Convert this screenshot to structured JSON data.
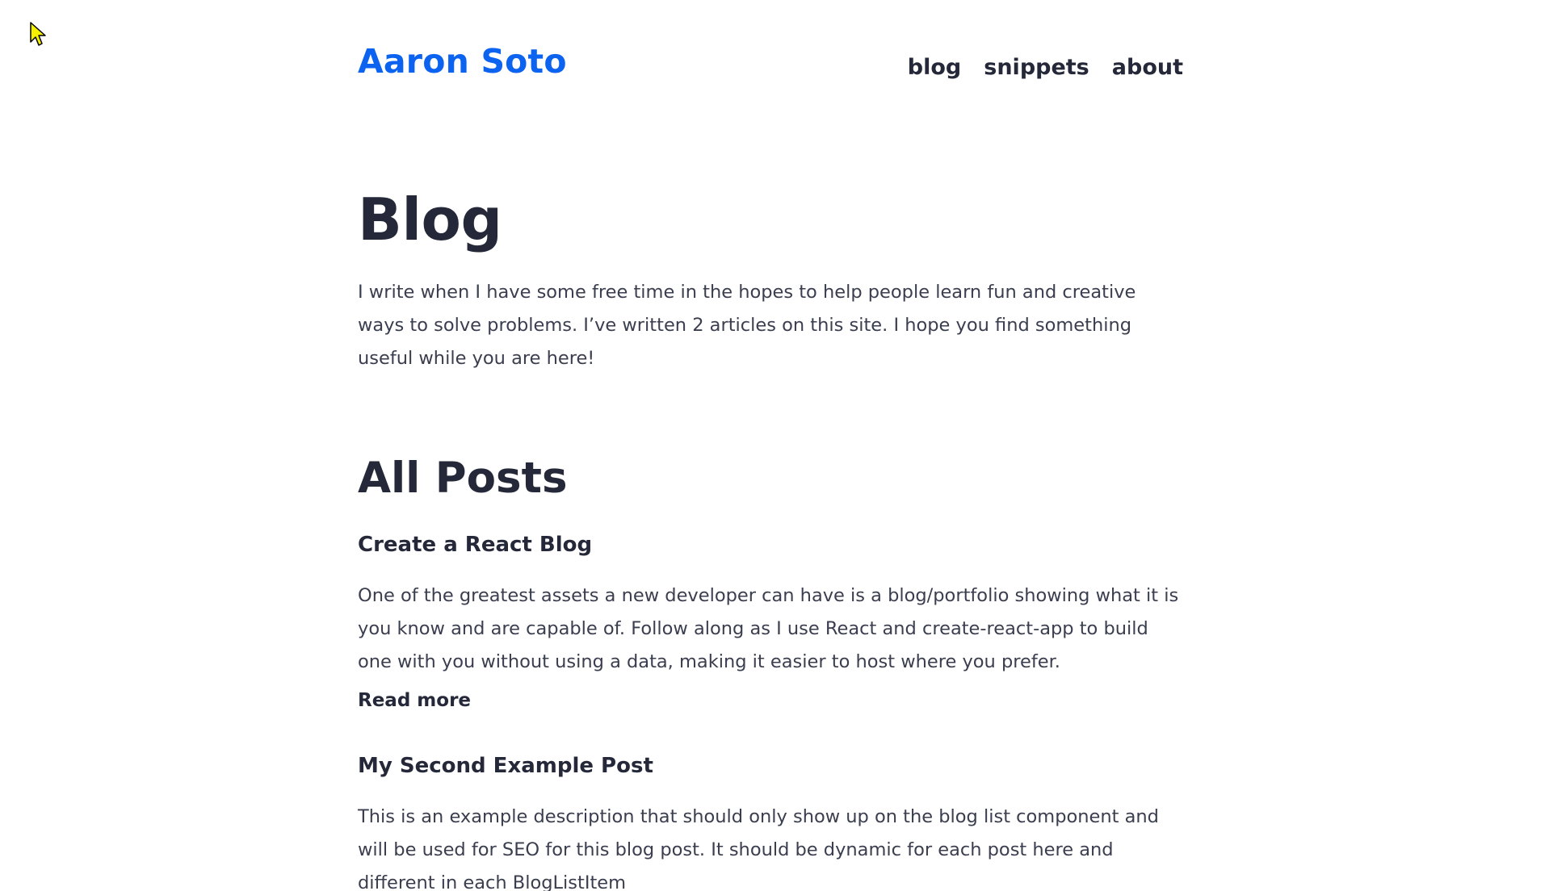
{
  "header": {
    "site_title": "Aaron Soto",
    "nav": [
      {
        "label": "blog"
      },
      {
        "label": "snippets"
      },
      {
        "label": "about"
      }
    ]
  },
  "main": {
    "page_heading": "Blog",
    "intro": "I write when I have some free time in the hopes to help people learn fun and creative ways to solve problems. I’ve written 2 articles on this site. I hope you find something useful while you are here!",
    "section_heading": "All Posts",
    "posts": [
      {
        "title": "Create a React Blog",
        "description": "One of the greatest assets a new developer can have is a blog/portfolio showing what it is you know and are capable of. Follow along as I use React and create-react-app to build one with you without using a data, making it easier to host where you prefer.",
        "read_more": "Read more"
      },
      {
        "title": "My Second Example Post",
        "description": "This is an example description that should only show up on the blog list component and will be used for SEO for this blog post. It should be dynamic for each post here and different in each BlogListItem"
      }
    ]
  },
  "colors": {
    "accent": "#0b63f0",
    "text": "#242838",
    "body_text": "#3a3e4f",
    "cursor": "#f5f000"
  },
  "icons": {
    "cursor": "mouse-pointer-icon"
  }
}
